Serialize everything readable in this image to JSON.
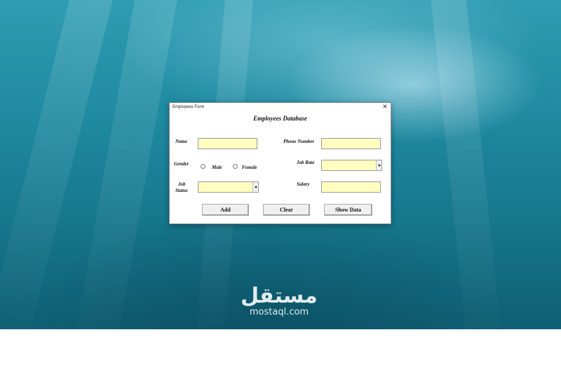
{
  "window": {
    "title": "Employees Form",
    "close_glyph": "✕"
  },
  "form": {
    "heading": "Employees Database",
    "labels": {
      "name": "Name",
      "gender": "Gender",
      "job_status_line1": "Job",
      "job_status_line2": "Status",
      "phone_number": "Phone Number",
      "job_rate": "Job Rate",
      "salary": "Salary"
    },
    "gender_options": [
      "Male",
      "Female"
    ],
    "fields": {
      "name": "",
      "phone_number": "",
      "job_rate": "",
      "job_status": "",
      "salary": ""
    },
    "buttons": {
      "add": "Add",
      "clear": "Clear",
      "show_data": "Show Data"
    }
  },
  "watermark": {
    "logo_text": "مستقل",
    "site": "mostaql.com"
  },
  "colors": {
    "field_background": "#ffffc0",
    "desktop_water": "#1f8aa1"
  },
  "icons": [
    "close-icon",
    "dropdown-arrow-icon",
    "radio-icon"
  ]
}
